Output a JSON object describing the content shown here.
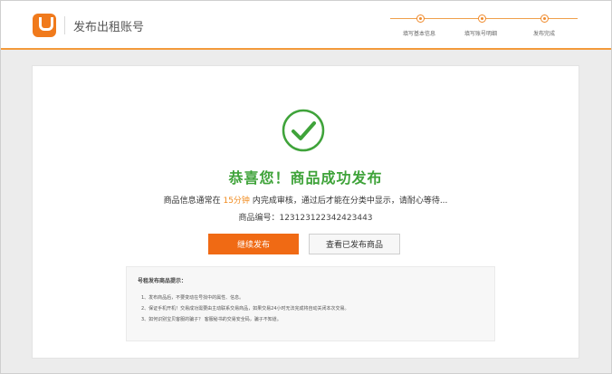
{
  "header": {
    "title": "发布出租账号",
    "steps": [
      {
        "label": "填写基本信息"
      },
      {
        "label": "填写账号明细"
      },
      {
        "label": "发布完成"
      }
    ]
  },
  "result": {
    "icon": "check-circle-icon",
    "title": "恭喜您！商品成功发布",
    "info_prefix": "商品信息通常在",
    "info_highlight": "15分钟",
    "info_suffix": "内完成审核，通过后才能在分类中显示，请耐心等待...",
    "code_label": "商品编号：",
    "code_value": "123123122342423443",
    "continue_label": "继续发布",
    "view_label": "查看已发布商品"
  },
  "tips": {
    "title": "号租发布商品提示：",
    "items": [
      "1、发布商品后，不要变动在号找中的属性、信息。",
      "2、保证手机开机！交易成功需要由主动联系交易商品，如果交易24小时无法完成将自动关闭本次交易。",
      "3、如何识别宝贝客服的骗子？  客服秘书的交易安全码，骗子不知道。"
    ]
  },
  "colors": {
    "accent": "#f06a14",
    "success": "#3fa33a",
    "highlight": "#f08a1c"
  }
}
